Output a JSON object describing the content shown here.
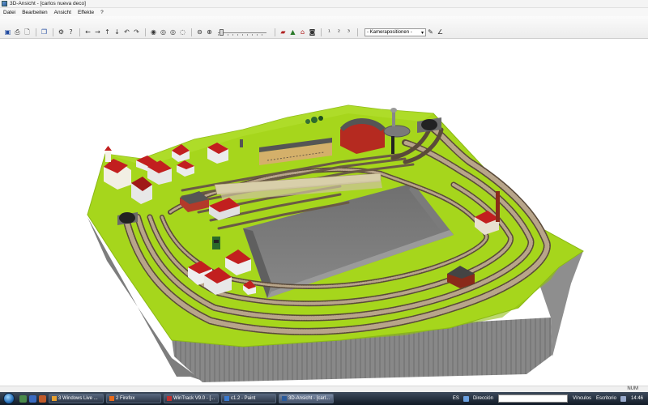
{
  "window": {
    "title": "3D-Ansicht - [carlos nueva deco]"
  },
  "menu": [
    "Datei",
    "Bearbeiten",
    "Ansicht",
    "Effekte",
    "?"
  ],
  "toolbar": {
    "icons": [
      "save-icon",
      "print-icon",
      "print-preview-icon",
      "sep",
      "copy-icon",
      "sep",
      "settings-icon",
      "help-icon",
      "sep",
      "arrow-left-icon",
      "arrow-right-icon",
      "arrow-up-icon",
      "arrow-down-icon",
      "rotate-left-icon",
      "rotate-right-icon",
      "sep",
      "eye-move-icon",
      "eye-rotate-icon",
      "eye-rotate2-icon",
      "eye-orbit-icon",
      "sep",
      "zoom-out-icon",
      "zoom-in-icon"
    ],
    "icons2": [
      "train-icon",
      "landscape-icon",
      "house-icon",
      "camera-icon",
      "sep",
      "cam1-icon",
      "cam2-icon",
      "cam3-icon",
      "sep"
    ],
    "camera_label": "- Kamerapositionen -",
    "icons3": [
      "pen-icon",
      "angle-icon"
    ]
  },
  "status": {
    "num": "NUM"
  },
  "taskbar": {
    "tasks": [
      {
        "label": "3 Windows Live ...",
        "color": "#e6a030"
      },
      {
        "label": "2 Firefox",
        "color": "#e86a1a"
      },
      {
        "label": "WinTrack V9.0 - [...",
        "color": "#c03030"
      },
      {
        "label": "c1.2 - Paint",
        "color": "#3a7ad0"
      },
      {
        "label": "3D-Ansicht - [carl...",
        "color": "#2a5a9a",
        "active": true
      }
    ],
    "lang": "ES",
    "address_label": "Dirección",
    "links": "Vínculos",
    "desktop": "Escritorio",
    "clock": "14:46"
  },
  "colors": {
    "grass": "#a6d61c",
    "grass_dark": "#7fae12",
    "rock": "#8d8d8d",
    "rock_dark": "#6c6c6c",
    "track": "#8b7a63",
    "sleeper": "#5a4a3a",
    "roof": "#c21f1f"
  }
}
